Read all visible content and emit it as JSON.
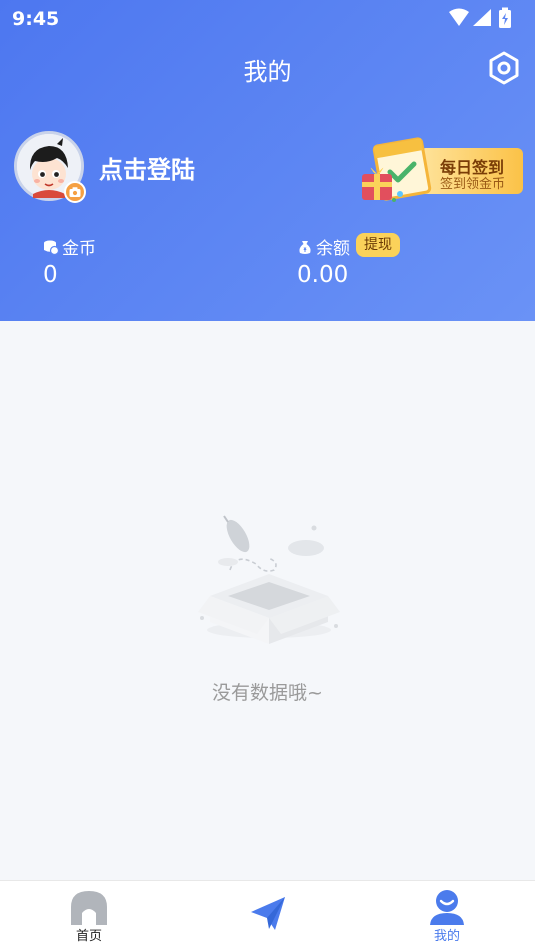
{
  "status_bar": {
    "time": "9:45"
  },
  "header": {
    "title": "我的"
  },
  "profile": {
    "login_text": "点击登陆"
  },
  "daily_signin": {
    "title": "每日签到",
    "subtitle": "签到领金币"
  },
  "stats": {
    "coins": {
      "label": "金币",
      "value": "0"
    },
    "balance": {
      "label": "余额",
      "value": "0.00",
      "withdraw_label": "提现"
    }
  },
  "empty_state": {
    "message": "没有数据哦~"
  },
  "tabbar": {
    "tabs": [
      {
        "label": "首页",
        "icon": "home-icon",
        "active": false
      },
      {
        "label": "",
        "icon": "paper-plane-icon",
        "active": false
      },
      {
        "label": "我的",
        "icon": "user-icon",
        "active": true
      }
    ]
  },
  "colors": {
    "header_start": "#4d77f0",
    "header_end": "#6a92f6",
    "accent": "#4b7bec",
    "badge": "#fbd25a"
  }
}
